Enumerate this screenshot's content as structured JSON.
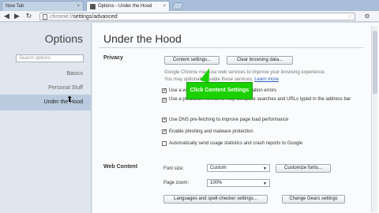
{
  "tabs": [
    {
      "label": "New Tab",
      "active": false
    },
    {
      "label": "Options - Under the Hood",
      "active": true
    }
  ],
  "toolbar": {
    "url_scheme": "chrome://",
    "url_path": "settings/advanced"
  },
  "sidebar": {
    "title": "Options",
    "search_placeholder": "Search options",
    "items": [
      {
        "label": "Basics",
        "selected": false
      },
      {
        "label": "Personal Stuff",
        "selected": false
      },
      {
        "label": "Under the Hood",
        "selected": true
      }
    ]
  },
  "main": {
    "title": "Under the Hood",
    "privacy": {
      "label": "Privacy",
      "content_settings_button": "Content settings...",
      "clear_browsing_button": "Clear browsing data...",
      "intro_line1": "Google Chrome may use web services to improve your browsing experience.",
      "intro_line2": "You may optionally disable these services.",
      "learn_more": "Learn more",
      "options": [
        {
          "label": "Use a web service to help resolve navigation errors",
          "checked": true
        },
        {
          "label": "Use a prediction service to help complete searches and URLs typed in the address bar",
          "checked": true
        },
        {
          "label": "Use DNS pre-fetching to improve page load performance",
          "checked": true
        },
        {
          "label": "Enable phishing and malware protection",
          "checked": true
        },
        {
          "label": "Automatically send usage statistics and crash reports to Google",
          "checked": false
        }
      ]
    },
    "web_content": {
      "label": "Web Content",
      "font_size_label": "Font size:",
      "font_size_value": "Custom",
      "customize_fonts_button": "Customize fonts...",
      "page_zoom_label": "Page zoom:",
      "page_zoom_value": "100%",
      "languages_button": "Languages and spell-checker settings...",
      "gears_button": "Change Gears settings"
    }
  },
  "tooltip": {
    "text": "Click Content Settings"
  },
  "colors": {
    "tooltip_bg": "#1bd100",
    "sidebar_selected": "#bacbdf",
    "link": "#2b5fbf"
  }
}
